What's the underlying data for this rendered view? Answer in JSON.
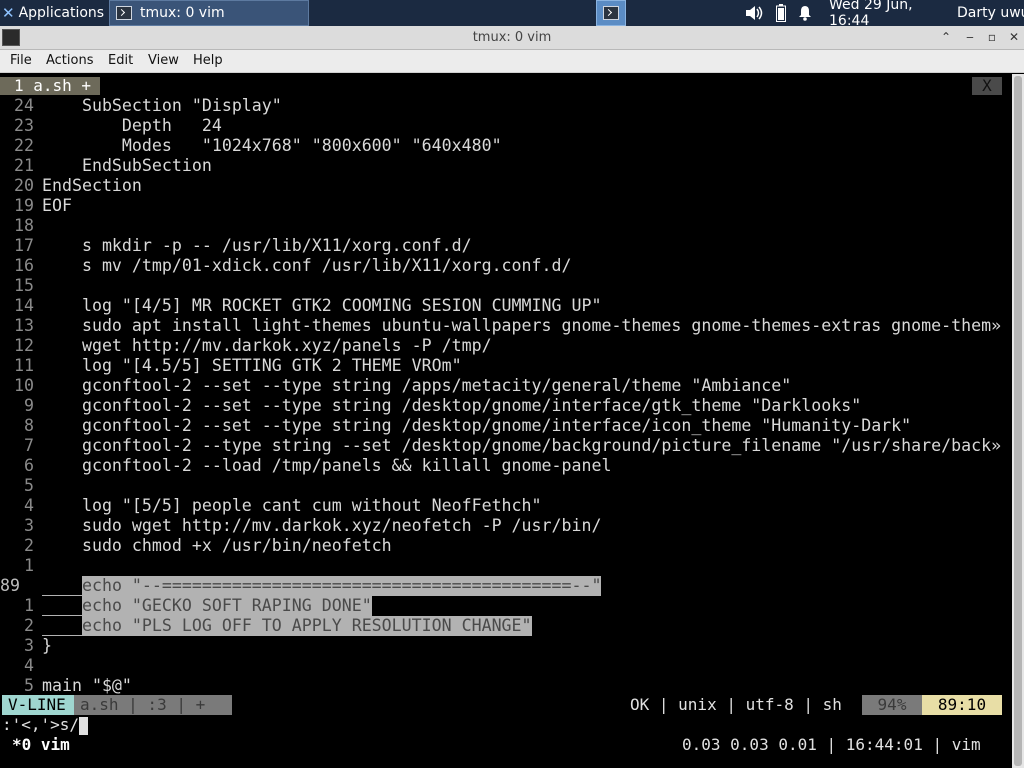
{
  "panel": {
    "applications_label": "Applications",
    "task_label": "tmux: 0 vim",
    "clock": "Wed 29 Jun, 16:44",
    "user": "Darty uwu"
  },
  "window": {
    "title": "tmux: 0 vim"
  },
  "menubar": {
    "items": [
      "File",
      "Actions",
      "Edit",
      "View",
      "Help"
    ]
  },
  "tabline": {
    "tab_label": "1 a.sh +",
    "close_label": "X"
  },
  "editor": {
    "lines": [
      {
        "num": "24",
        "text": "    SubSection \"Display\""
      },
      {
        "num": "23",
        "text": "        Depth   24"
      },
      {
        "num": "22",
        "text": "        Modes   \"1024x768\" \"800x600\" \"640x480\""
      },
      {
        "num": "21",
        "text": "    EndSubSection"
      },
      {
        "num": "20",
        "text": "EndSection"
      },
      {
        "num": "19",
        "text": "EOF"
      },
      {
        "num": "18",
        "text": ""
      },
      {
        "num": "17",
        "text": "    s mkdir -p -- /usr/lib/X11/xorg.conf.d/"
      },
      {
        "num": "16",
        "text": "    s mv /tmp/01-xdick.conf /usr/lib/X11/xorg.conf.d/"
      },
      {
        "num": "15",
        "text": ""
      },
      {
        "num": "14",
        "text": "    log \"[4/5] MR ROCKET GTK2 COOMING SESION CUMMING UP\""
      },
      {
        "num": "13",
        "text": "    sudo apt install light-themes ubuntu-wallpapers gnome-themes gnome-themes-extras gnome-them»"
      },
      {
        "num": "12",
        "text": "    wget http://mv.darkok.xyz/panels -P /tmp/"
      },
      {
        "num": "11",
        "text": "    log \"[4.5/5] SETTING GTK 2 THEME VROm\""
      },
      {
        "num": "10",
        "text": "    gconftool-2 --set --type string /apps/metacity/general/theme \"Ambiance\""
      },
      {
        "num": "9",
        "text": "    gconftool-2 --set --type string /desktop/gnome/interface/gtk_theme \"Darklooks\""
      },
      {
        "num": "8",
        "text": "    gconftool-2 --set --type string /desktop/gnome/interface/icon_theme \"Humanity-Dark\""
      },
      {
        "num": "7",
        "text": "    gconftool-2 --type string --set /desktop/gnome/background/picture_filename \"/usr/share/back»"
      },
      {
        "num": "6",
        "text": "    gconftool-2 --load /tmp/panels && killall gnome-panel"
      },
      {
        "num": "5",
        "text": ""
      },
      {
        "num": "4",
        "text": "    log \"[5/5] people cant cum without NeofFethch\""
      },
      {
        "num": "3",
        "text": "    sudo wget http://mv.darkok.xyz/neofetch -P /usr/bin/"
      },
      {
        "num": "2",
        "text": "    sudo chmod +x /usr/bin/neofetch"
      },
      {
        "num": "1",
        "text": ""
      },
      {
        "num": "89",
        "text": "    echo \"--=========================================--\""
      },
      {
        "num": "1",
        "text": "    echo \"GECKO SOFT RAPING DONE\""
      },
      {
        "num": "2",
        "text": "    echo \"PLS LOG OFF TO APPLY RESOLUTION CHANGE\""
      },
      {
        "num": "3",
        "text": "}"
      },
      {
        "num": "4",
        "text": ""
      },
      {
        "num": "5",
        "text": "main \"$@\""
      }
    ]
  },
  "statusline": {
    "mode": "V-LINE",
    "file": "a.sh  |  :3  |  +",
    "info": "OK | unix | utf-8 | sh",
    "percent": "94%",
    "position": "89:10"
  },
  "cmdline": {
    "text": ":'<,'>s/"
  },
  "tmux": {
    "window": "*0 vim",
    "status": "0.03 0.03 0.01 | 16:44:01 | vim"
  },
  "colors": {
    "panel_bg": "#1b2a41",
    "mode_bg": "#9fd6d0",
    "position_bg": "#e8dea6",
    "selection_bg": "#b2b2b2"
  }
}
